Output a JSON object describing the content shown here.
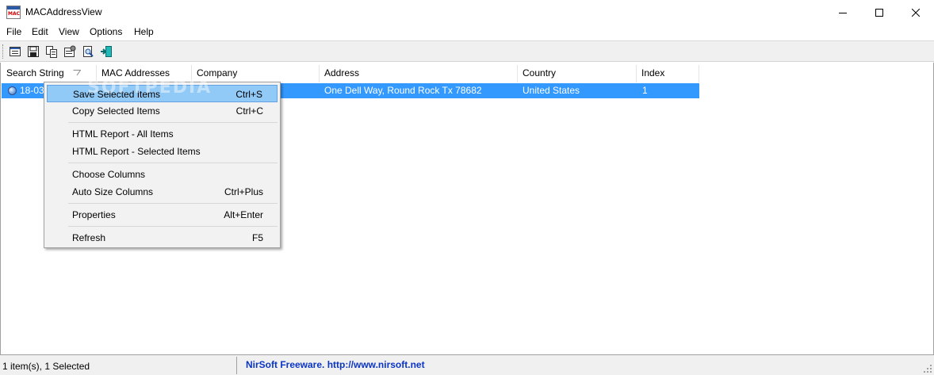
{
  "window": {
    "title": "MACAddressView",
    "app_icon_text": "MAC",
    "app_icon_name": "app-icon"
  },
  "menu": [
    "File",
    "Edit",
    "View",
    "Options",
    "Help"
  ],
  "toolbar": {
    "buttons": [
      "report-icon",
      "save-icon",
      "copy-icon",
      "properties-icon",
      "search-icon",
      "exit-icon"
    ]
  },
  "columns": [
    "Search String",
    "MAC Addresses",
    "Company",
    "Address",
    "Country",
    "Index"
  ],
  "rows": [
    {
      "search_string": "18-03",
      "address": "One Dell Way, Round Rock  Tx  78682",
      "country": "United States",
      "index": "1"
    }
  ],
  "watermark": "SOFTPEDIA",
  "context_menu": {
    "items": [
      {
        "label": "Save Selected Items",
        "shortcut": "Ctrl+S",
        "highlighted": true
      },
      {
        "label": "Copy Selected Items",
        "shortcut": "Ctrl+C"
      },
      {
        "label": "HTML Report - All Items",
        "shortcut": ""
      },
      {
        "label": "HTML Report - Selected Items",
        "shortcut": ""
      },
      {
        "label": "Choose Columns",
        "shortcut": ""
      },
      {
        "label": "Auto Size Columns",
        "shortcut": "Ctrl+Plus"
      },
      {
        "label": "Properties",
        "shortcut": "Alt+Enter"
      },
      {
        "label": "Refresh",
        "shortcut": "F5"
      }
    ]
  },
  "status": {
    "items_text": "1 item(s), 1 Selected",
    "link_text": "NirSoft Freeware.  http://www.nirsoft.net"
  },
  "colors": {
    "selection": "#3399ff",
    "menu_highlight": "#91c9f7",
    "link": "#0a35c4"
  }
}
